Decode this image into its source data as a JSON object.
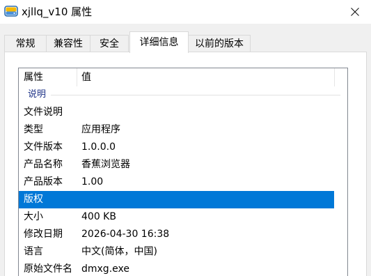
{
  "window": {
    "title": "xjllq_v10 属性",
    "icon": "drive-folder-icon",
    "close_glyph": "✕"
  },
  "tabs": [
    {
      "label": "常规",
      "active": false
    },
    {
      "label": "兼容性",
      "active": false
    },
    {
      "label": "安全",
      "active": false
    },
    {
      "label": "详细信息",
      "active": true
    },
    {
      "label": "以前的版本",
      "active": false
    }
  ],
  "details": {
    "columns": {
      "property": "属性",
      "value": "值"
    },
    "group": "说明",
    "rows": [
      {
        "name": "文件说明",
        "value": ""
      },
      {
        "name": "类型",
        "value": "应用程序"
      },
      {
        "name": "文件版本",
        "value": "1.0.0.0"
      },
      {
        "name": "产品名称",
        "value": "香蕉浏览器"
      },
      {
        "name": "产品版本",
        "value": "1.00"
      },
      {
        "name": "版权",
        "value": "",
        "selected": true
      },
      {
        "name": "大小",
        "value": "400 KB"
      },
      {
        "name": "修改日期",
        "value": "2026-04-30 16:38"
      },
      {
        "name": "语言",
        "value": "中文(简体，中国)"
      },
      {
        "name": "原始文件名",
        "value": "dmxg.exe"
      }
    ]
  },
  "colors": {
    "selection": "#0078d7",
    "group_text": "#1e3287",
    "dialog_bg": "#f0f0f0"
  }
}
